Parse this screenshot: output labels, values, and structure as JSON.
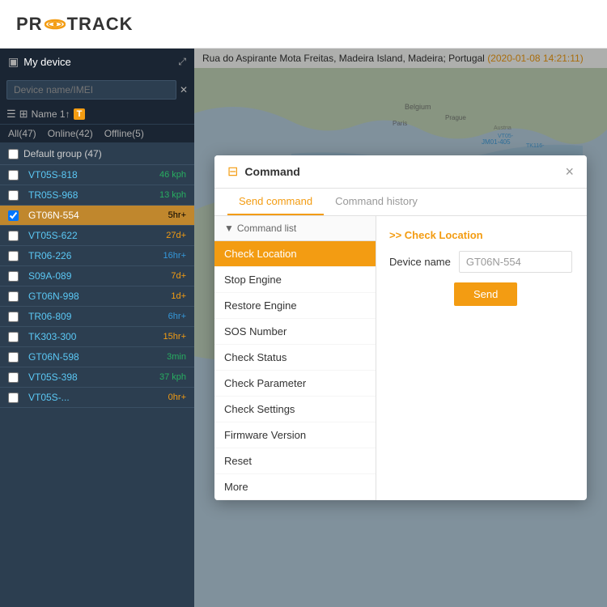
{
  "logo": {
    "text_before": "PR",
    "text_after": "TRACK"
  },
  "sidebar": {
    "header_title": "My device",
    "search_placeholder": "Device name/IMEI",
    "filter_label": "Name 1↑",
    "tabs": [
      {
        "label": "All(47)",
        "active": false
      },
      {
        "label": "Online(42)",
        "active": false
      },
      {
        "label": "Offline(5)",
        "active": false
      }
    ],
    "group_label": "Default group (47)",
    "devices": [
      {
        "name": "VT05S-818",
        "status": "46 kph",
        "status_class": "status-green",
        "selected": false
      },
      {
        "name": "TR05S-968",
        "status": "13 kph",
        "status_class": "status-green",
        "selected": false
      },
      {
        "name": "GT06N-554",
        "status": "5hr+",
        "status_class": "status-orange",
        "selected": true
      },
      {
        "name": "VT05S-622",
        "status": "27d+",
        "status_class": "status-orange",
        "selected": false
      },
      {
        "name": "TR06-226",
        "status": "16hr+",
        "status_class": "status-blue",
        "selected": false
      },
      {
        "name": "S09A-089",
        "status": "7d+",
        "status_class": "status-orange",
        "selected": false
      },
      {
        "name": "GT06N-998",
        "status": "1d+",
        "status_class": "status-orange",
        "selected": false
      },
      {
        "name": "TR06-809",
        "status": "6hr+",
        "status_class": "status-blue",
        "selected": false
      },
      {
        "name": "TK303-300",
        "status": "15hr+",
        "status_class": "status-orange",
        "selected": false
      },
      {
        "name": "GT06N-598",
        "status": "3min",
        "status_class": "status-green",
        "selected": false
      },
      {
        "name": "VT05S-398",
        "status": "37 kph",
        "status_class": "status-green",
        "selected": false
      },
      {
        "name": "VT05S-...",
        "status": "0hr+",
        "status_class": "status-orange",
        "selected": false
      }
    ]
  },
  "map": {
    "address": "Rua do Aspirante Mota Freitas, Madeira Island, Madeira; Portugal",
    "timestamp": "(2020-01-08 14:21:11)",
    "marker_count": "5"
  },
  "modal": {
    "title": "Command",
    "close_label": "×",
    "tabs": [
      {
        "label": "Send command",
        "active": true
      },
      {
        "label": "Command history",
        "active": false
      }
    ],
    "command_list_header": "Command list",
    "commands": [
      {
        "label": "Check Location",
        "selected": true
      },
      {
        "label": "Stop Engine",
        "selected": false
      },
      {
        "label": "Restore Engine",
        "selected": false
      },
      {
        "label": "SOS Number",
        "selected": false
      },
      {
        "label": "Check Status",
        "selected": false
      },
      {
        "label": "Check Parameter",
        "selected": false
      },
      {
        "label": "Check Settings",
        "selected": false
      },
      {
        "label": "Firmware Version",
        "selected": false
      },
      {
        "label": "Reset",
        "selected": false
      },
      {
        "label": "More",
        "selected": false
      }
    ],
    "selected_command_link": ">> Check Location",
    "device_name_label": "Device name",
    "device_name_value": "GT06N-554",
    "send_button_label": "Send"
  }
}
